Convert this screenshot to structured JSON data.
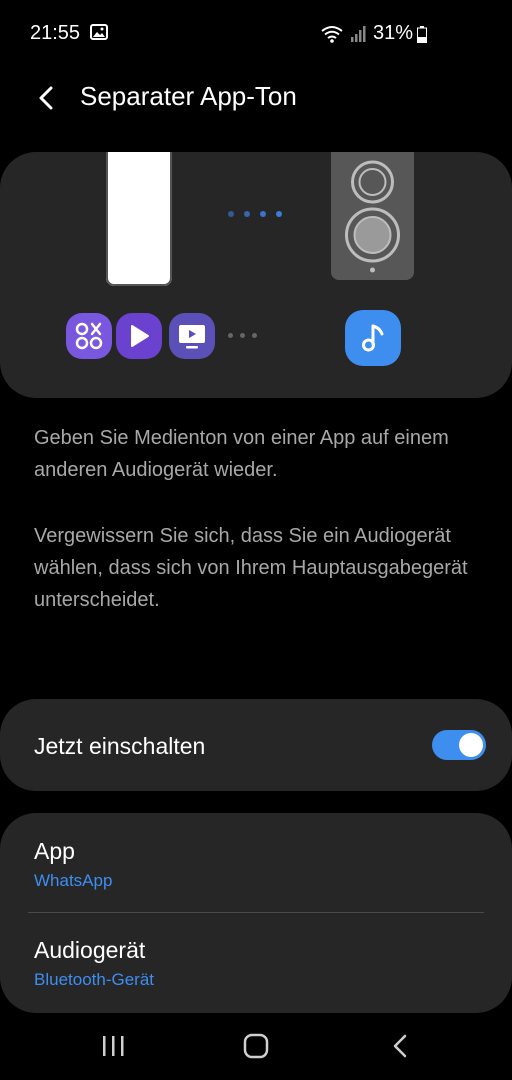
{
  "status_bar": {
    "time": "21:55",
    "battery_percent": "31%",
    "icons": [
      "photo-icon",
      "wifi-icon",
      "signal-icon",
      "battery-icon"
    ]
  },
  "header": {
    "back_icon": "chevron-left-icon",
    "title": "Separater App-Ton"
  },
  "illustration": {
    "icons": [
      "phone-icon",
      "speaker-icon",
      "games-app-icon",
      "play-app-icon",
      "tv-app-icon",
      "music-icon"
    ]
  },
  "descriptions": [
    "Geben Sie Medienton von einer App auf einem anderen Audiogerät wieder.",
    "Vergewissern Sie sich, dass Sie ein Audiogerät wählen, dass sich von Ihrem Hauptausgabegerät unterscheidet."
  ],
  "toggle": {
    "label": "Jetzt einschalten",
    "on": true
  },
  "settings": {
    "app": {
      "title": "App",
      "value": "WhatsApp"
    },
    "audio_device": {
      "title": "Audiogerät",
      "value": "Bluetooth-Gerät"
    }
  },
  "colors": {
    "accent": "#3e8ef0",
    "card": "#262626",
    "background": "#000000",
    "secondary_text": "#a8a8a8"
  },
  "nav_bar": {
    "icons": [
      "recent-apps-icon",
      "home-icon",
      "back-icon"
    ]
  }
}
